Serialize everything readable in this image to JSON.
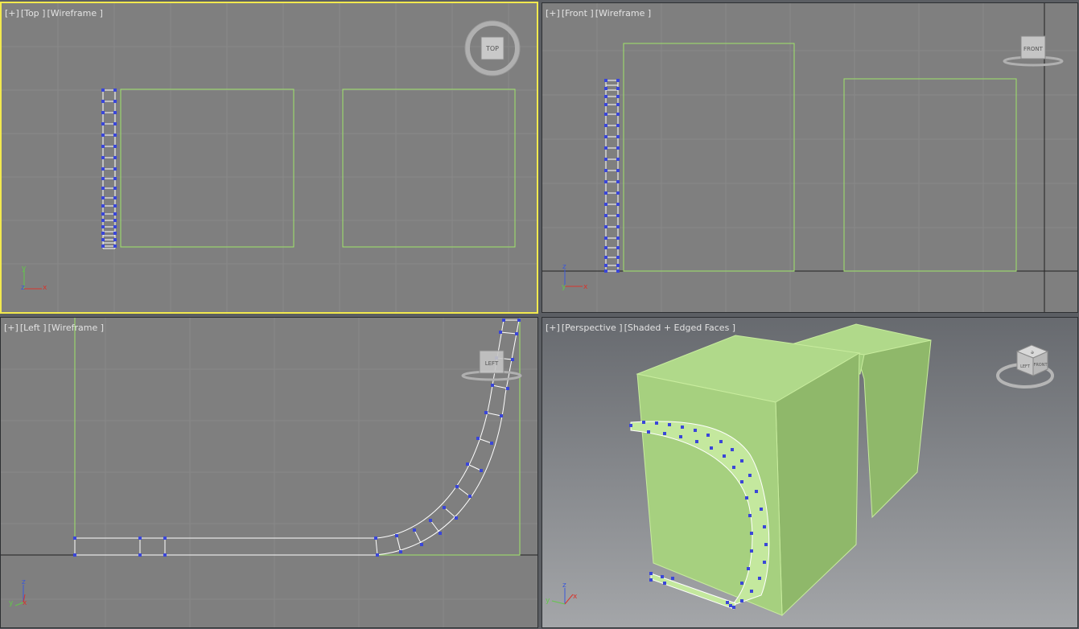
{
  "viewports": {
    "top": {
      "plus": "[+]",
      "view": "[Top ]",
      "mode": "[Wireframe ]",
      "cube": "TOP",
      "axis_up": "y",
      "axis_right": "x",
      "axis_depth": "z"
    },
    "front": {
      "plus": "[+]",
      "view": "[Front ]",
      "mode": "[Wireframe ]",
      "cube": "FRONT",
      "axis_up": "z",
      "axis_right": "x",
      "axis_depth": "y"
    },
    "left": {
      "plus": "[+]",
      "view": "[Left ]",
      "mode": "[Wireframe ]",
      "cube": "LEFT",
      "axis_up": "z",
      "axis_right": "x",
      "axis_depth": "y"
    },
    "perspective": {
      "plus": "[+]",
      "view": "[Perspective ]",
      "mode": "[Shaded + Edged Faces ]",
      "cube_top": "ǝ",
      "cube_left": "LEFT",
      "cube_front": "FRONT",
      "axis_up": "z",
      "axis_right": "x",
      "axis_depth": "y"
    }
  },
  "colors": {
    "viewport_bg": "#7f7f7f",
    "grid": "#8a8a8a",
    "active_border": "#f2e94e",
    "box_wire": "#9fe46a",
    "spline": "#ffffff",
    "vertex": "#3a46d8",
    "box_fill": "#a9d47e",
    "box_fill_dark": "#8fb86a"
  }
}
